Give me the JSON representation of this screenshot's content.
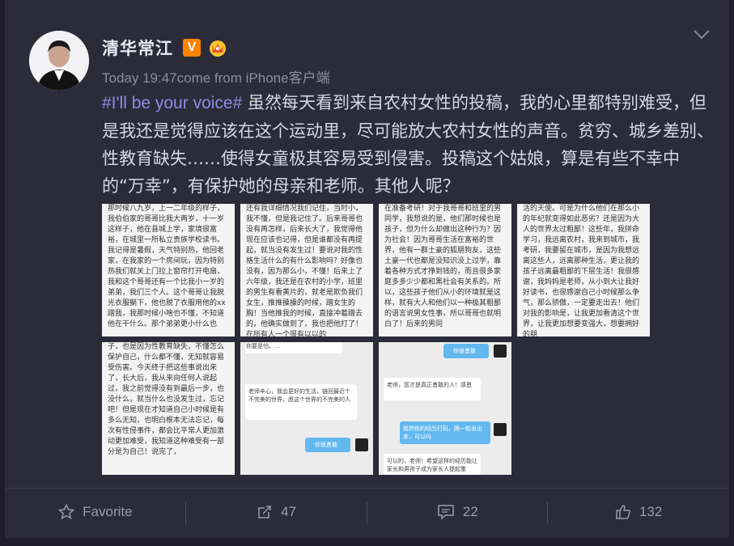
{
  "post": {
    "author": "清华常江",
    "meta": "Today 19:47come from iPhone客户端",
    "hashtag": "#I'll be your voice#",
    "body": " 虽然每天看到来自农村女性的投稿，我的心里都特别难受，但是我还是觉得应该在这个运动里，尽可能放大农村女性的声音。贫穷、城乡差别、性教育缺失……使得女童极其容易受到侵害。投稿这个姑娘，算是有些不幸中的“万幸”，有保护她的母亲和老师。其他人呢？"
  },
  "images": [
    {
      "text": "那时候八九岁，上一二年级的样子，我伯伯家的哥哥比我大两岁，十一岁这样子，他在县城上学，家境很富裕，在城里一所私立贵族学校读书。我记得是暑假，天气特别热，他回老家，在我家的一个房间玩，因为特别热我们就关上门拉上窗帘打开电扇，我和这个哥哥还有一个比我小一岁的弟弟，我们三个人。这个哥哥让我脱光衣服躺下，他也脱了衣服用他的xx蹭我，我那时候小啥也不懂，不知道他在干什么。那个弟弟更小什么也"
    },
    {
      "text": "还有我详细情况我们记住，当时小，我不懂，但是我记住了。后来哥哥也没有再怎样，后来长大了，我觉得他现在应该也记得，但是谁都没有再提起，就当没有发生过！要说对我的性格生活什么的有什么影响吗？好像也没有，因为那么小，不懂！后来上了六年级，我还是在农村的小学，班里的男生有看黄片的，就老是欺负我们女生，推推搡搡的时候，蹭女生的胸！当他推我的时候，直接冲着蹭去的，他确实做到了，我也把他打了！在所有人一个很有以以的"
    },
    {
      "text": "在准备考研！对于我哥哥和班里的男同学，我想说的是，他们那时候也是孩子，但为什么却做出这种行为？因为社会！因为哥哥生活在富裕的世界，他有一群土豪的狐朋狗友，这些土豪一代也都是没知识没上过学，靠着各种方式才挣到钱的，而且很多家庭多多少少都和黑社会有关系的。所以，这些孩子他们从小的环境就是这样，就有大人和他们以一种极其粗鄙的语言说男女性事，所以哥哥也就明白了！后来的男同"
    },
    {
      "text": "活的天使。可是为什么他们在那么小的年纪就变得如此恶劣？还是因为大人的世界太过粗鄙！这些年，我拼命学习，我远离农村，我来到城市，我考研，我要留在城市，是因为我想远离这些人，远离那种生活，更让我的孩子远离最粗鄙的下层生活！我很感谢，我妈妈是老师，从小到大让我好好读书，也很感谢自己小时候那么争气，那么骄傲，一定要走出去！他们对我的影响是，让我更加看清这个世界，让我更加想要变强大，想要拥好的朋"
    },
    {
      "text": "子，也是因为性教育缺失，不懂怎么保护自己，什么都不懂，无知就容易受伤害。今天终于把这些事说出来了，长大后，我从来向任何人说起过，我之前觉得没有到最后一步，也没什么，就当什么也没发生过，忘记吧！但是现在才知道自己小时候是有多么无知，也明白根本无法忘记，每次有性侵事件，都会比平常人更加激动更加难受，我知道这种难受有一部分是为自己！说完了，"
    },
    {
      "chat_top": "你要是怕，…",
      "chat_mid": "老师辛心，我会更好的生活，链回最近个不完美的世界，愿这个世界的不完美的人",
      "chat_btm": "你很勇敢"
    },
    {
      "chat_top": "你很勇敢",
      "chat_mid": "老师，您才是真正勇敢的人！感恩",
      "chat_mid2": "我把你的经历打码，腾一般发出来，可以吗",
      "chat_btm": "可以的，老师！希望这样的经历能让家长和男孩子成为家长人提起重"
    }
  ],
  "footer": {
    "favorite": "Favorite",
    "forward": "47",
    "comment": "22",
    "like": "132"
  }
}
